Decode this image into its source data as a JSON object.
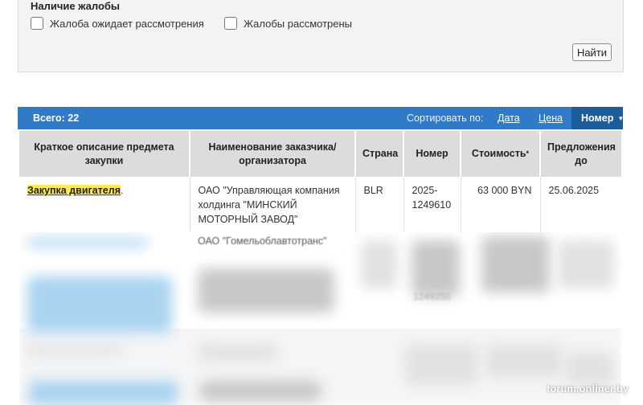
{
  "filter": {
    "title": "Наличие жалобы",
    "options": [
      {
        "label": "Жалоба ожидает рассмотрения",
        "checked": false
      },
      {
        "label": "Жалобы рассмотрены",
        "checked": false
      }
    ],
    "find_button": "Найти"
  },
  "results_bar": {
    "total": "Всего: 22",
    "sort_label": "Сортировать по:",
    "sort_options": [
      "Дата",
      "Цена",
      "Номер"
    ],
    "active_sort": "Номер",
    "accent_color": "#2f7bc8"
  },
  "table": {
    "headers": [
      "Краткое описание предмета закупки",
      "Наименование заказчика/ организатора",
      "Страна",
      "Номер",
      "Стоимость",
      "Предложения до"
    ],
    "cost_marker": "*",
    "rows": [
      {
        "subject": "Закупка двигателя",
        "subject_suffix": ".",
        "organizer": "ОАО \"Управляющая компания холдинга \"МИНСКИЙ МОТОРНЫЙ ЗАВОД\"",
        "country": "BLR",
        "number": "2025-1249610",
        "cost": "63 000 BYN",
        "deadline": "25.06.2025"
      }
    ],
    "partial_row": {
      "organizer": "ОАО \"Гомельоблавтотранс\"",
      "number": "1249250"
    }
  },
  "watermark": "forum.onliner.by"
}
